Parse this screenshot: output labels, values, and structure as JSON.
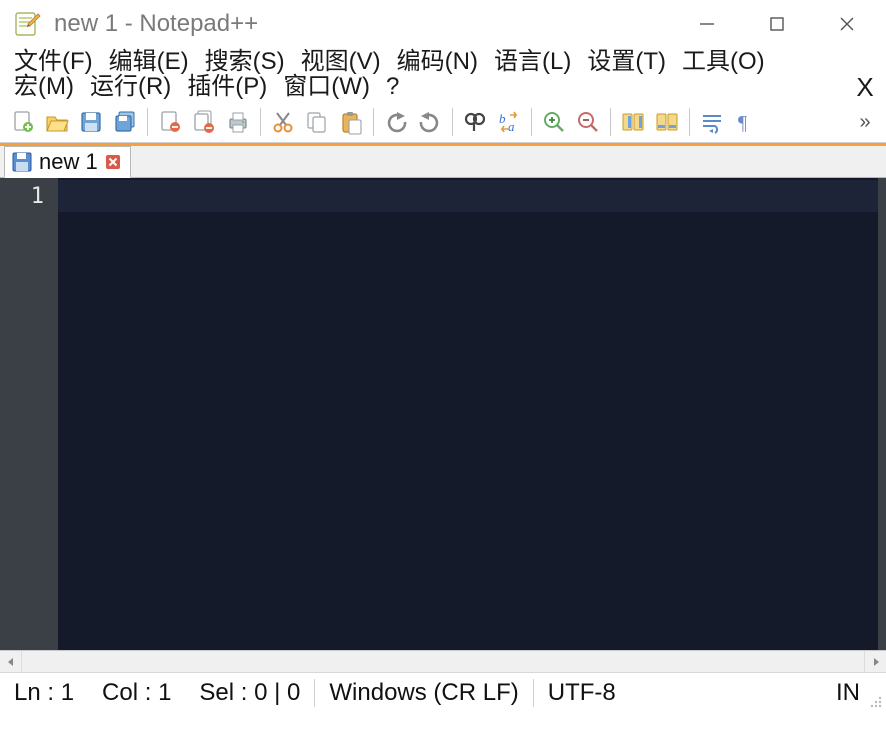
{
  "window": {
    "title": "new 1 - Notepad++"
  },
  "menu": {
    "file": "文件(F)",
    "edit": "编辑(E)",
    "search": "搜索(S)",
    "view": "视图(V)",
    "encoding": "编码(N)",
    "language": "语言(L)",
    "settings": "设置(T)",
    "tools": "工具(O)",
    "macro": "宏(M)",
    "run": "运行(R)",
    "plugins": "插件(P)",
    "window": "窗口(W)",
    "help": "?",
    "close_x": "X"
  },
  "toolbar_overflow": "»",
  "tab": {
    "label": "new 1"
  },
  "editor": {
    "line_number": "1"
  },
  "status": {
    "ln": "Ln : 1",
    "col": "Col : 1",
    "sel": "Sel : 0 | 0",
    "eol": "Windows (CR LF)",
    "encoding": "UTF-8",
    "ins": "IN"
  }
}
